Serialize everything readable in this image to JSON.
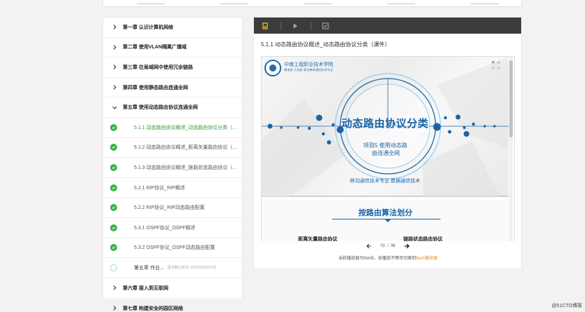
{
  "top_tabs": [
    "",
    "",
    "",
    "",
    ""
  ],
  "sidebar": {
    "chapters_before": [
      {
        "label": "第一章 认识计算机网络"
      },
      {
        "label": "第二章 使用VLAN隔离广播域"
      },
      {
        "label": "第三章 在局域网中使用冗余链路"
      },
      {
        "label": "第四章 使用静态路由连通全网"
      }
    ],
    "open_chapter": {
      "label": "第五章 使用动态路由协议连通全网"
    },
    "sections": [
      {
        "label": "5.1.1 动态路由协议概述_动态路由协议分类（课件）",
        "active": true
      },
      {
        "label": "5.1.2 动态路由协议概述_距离矢量路由协议（课件）"
      },
      {
        "label": "5.1.3 动态路由协议概述_链路状态路由协议（课件）"
      },
      {
        "label": "5.2.1 RIP协议_RIP概述"
      },
      {
        "label": "5.2.2 RIP协议_RIP动态路由配置"
      },
      {
        "label": "5.3.1 OSPF协议_OSPF概述"
      },
      {
        "label": "5.3.2 OSPF协议_OSPF动态路由配置"
      }
    ],
    "homework": {
      "title": "第五章 作业...",
      "meta": "提交截止时间: 2020年06月12日"
    },
    "chapters_after": [
      {
        "label": "第六章 接入到互联网"
      },
      {
        "label": "第七章 构建安全的园区网络"
      }
    ]
  },
  "main": {
    "lesson_title": "5.1.1 动态路由协议概述_动态路由协议分类（课件）",
    "slide": {
      "school_name": "中南工程职业技术学院",
      "school_sub": "教育部 工信部 职业教育通信技术专业",
      "title": "动态路由协议分类",
      "subtitle1": "项目5 使用动态路",
      "subtitle2": "由连通全网",
      "footer": "移动通信技术专业 数据通信技术"
    },
    "slide2": {
      "title": "按路由算法划分",
      "left": "距离矢量路由协议",
      "right": "链路状态路由协议"
    },
    "pager": {
      "current": "01",
      "total": "06",
      "separator": "/"
    },
    "note_prefix": "当前播放器为html5，如播放不畅可切换到",
    "note_link": "flash播放器"
  },
  "watermark": "@51CTO博客",
  "colors": {
    "accent_green": "#3bb34a",
    "slide_blue": "#1a65a8",
    "toolbar": "#3c3c3c",
    "link_orange": "#f08a24"
  }
}
